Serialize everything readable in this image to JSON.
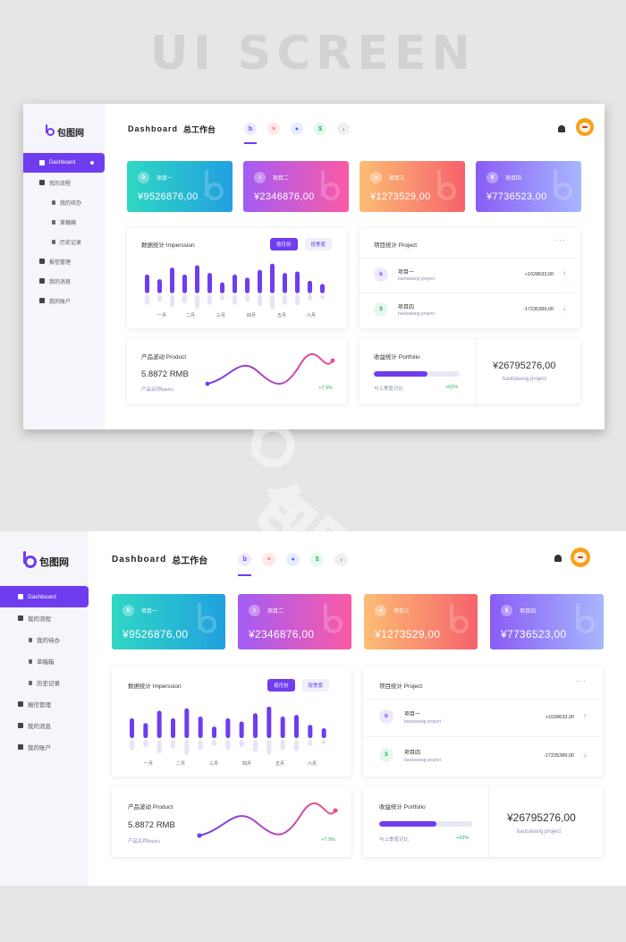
{
  "hero_title": "UI SCREEN",
  "brand": "包图网",
  "nav": [
    {
      "label": "Dashboard",
      "active": true
    },
    {
      "label": "我的流程",
      "active": false
    },
    {
      "label": "我的待办",
      "sub": true
    },
    {
      "label": "草稿箱",
      "sub": true
    },
    {
      "label": "历史记录",
      "sub": true
    },
    {
      "label": "报信管理",
      "active": false
    },
    {
      "label": "我的消息",
      "active": false
    },
    {
      "label": "我的账户",
      "active": false
    }
  ],
  "header": {
    "title": "Dashboard",
    "subtitle": "总工作台",
    "next": "›"
  },
  "tab_icons": [
    "b",
    "≡",
    "●",
    "$",
    "›"
  ],
  "cards": [
    {
      "name": "项目一",
      "value": "¥9526876,00",
      "icon": "b"
    },
    {
      "name": "项目二",
      "value": "¥2346876,00",
      "icon": "≡"
    },
    {
      "name": "项目三",
      "value": "¥1273529,00",
      "icon": "●"
    },
    {
      "name": "项目四",
      "value": "¥7736523,00",
      "icon": "$"
    }
  ],
  "impression": {
    "title": "数据统计 Imperssion",
    "btn_month": "按月份",
    "btn_quarter": "按季度",
    "months": [
      "一月",
      "二月",
      "三月",
      "四月",
      "五月",
      "六月"
    ]
  },
  "chart_data": {
    "type": "bar",
    "values": [
      24,
      18,
      33,
      24,
      36,
      26,
      14,
      24,
      20,
      30,
      38,
      26,
      28,
      16,
      12
    ],
    "shadow_values": [
      14,
      10,
      18,
      12,
      20,
      14,
      8,
      14,
      10,
      16,
      20,
      14,
      15,
      8,
      6
    ],
    "x_labels": [
      "一月",
      "二月",
      "三月",
      "四月",
      "五月",
      "六月"
    ],
    "grid": false
  },
  "project": {
    "title": "项目统计 Project",
    "more": "···",
    "rows": [
      {
        "name": "项目一",
        "sub": "baotuwang project",
        "value": "+1028633,00",
        "trend": "up",
        "icon": "b"
      },
      {
        "name": "项目四",
        "sub": "baotuwang project",
        "value": "-17235389,00",
        "trend": "down",
        "icon": "$"
      }
    ]
  },
  "product": {
    "title": "产品波动 Product",
    "value": "5.8872  RMB",
    "sub": "产品名称baotu",
    "change": "+7.9%"
  },
  "portfolio": {
    "title": "收益统计 Portfolio",
    "progress": 0.62,
    "sub": "与上季度对比",
    "change": "+63%",
    "amount": "¥26795276,00",
    "amount_sub": "baotuwang project"
  },
  "colors": {
    "accent": "#6f3cf0",
    "up": "#2bb266",
    "down": "#f0505a"
  }
}
